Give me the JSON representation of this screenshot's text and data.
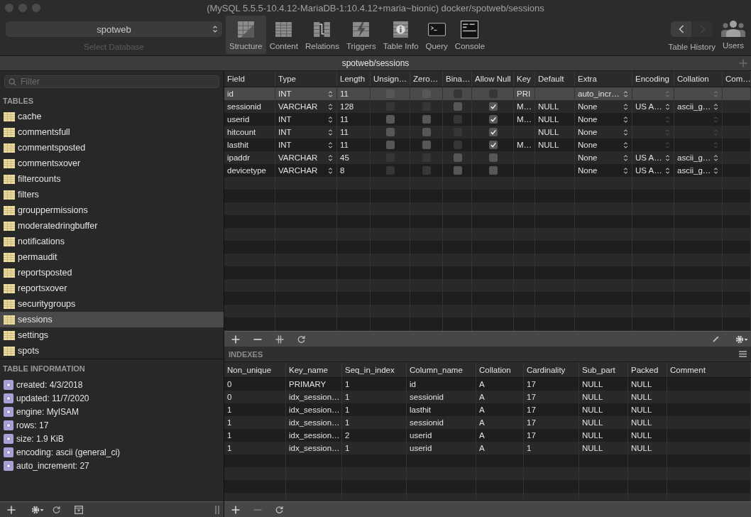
{
  "window": {
    "title": "(MySQL 5.5.5-10.4.12-MariaDB-1:10.4.12+maria~bionic) docker/spotweb/sessions"
  },
  "toolbar": {
    "database": {
      "value": "spotweb",
      "label": "Select Database"
    },
    "items": [
      {
        "label": "Structure",
        "kind": "structure",
        "selected": true
      },
      {
        "label": "Content",
        "kind": "content",
        "selected": false
      },
      {
        "label": "Relations",
        "kind": "relations",
        "selected": false
      },
      {
        "label": "Triggers",
        "kind": "triggers",
        "selected": false
      },
      {
        "label": "Table Info",
        "kind": "info",
        "selected": false
      },
      {
        "label": "Query",
        "kind": "query",
        "selected": false
      },
      {
        "label": "Console",
        "kind": "console",
        "selected": false
      }
    ],
    "history": {
      "label": "Table History",
      "back_enabled": true,
      "forward_enabled": false
    },
    "users": {
      "label": "Users"
    }
  },
  "path_bar": {
    "title": "spotweb/sessions"
  },
  "sidebar": {
    "filter": {
      "placeholder": "Filter"
    },
    "tables_title": "TABLES",
    "tables": [
      {
        "name": "cache",
        "selected": false
      },
      {
        "name": "commentsfull",
        "selected": false
      },
      {
        "name": "commentsposted",
        "selected": false
      },
      {
        "name": "commentsxover",
        "selected": false
      },
      {
        "name": "filtercounts",
        "selected": false
      },
      {
        "name": "filters",
        "selected": false
      },
      {
        "name": "grouppermissions",
        "selected": false
      },
      {
        "name": "moderatedringbuffer",
        "selected": false
      },
      {
        "name": "notifications",
        "selected": false
      },
      {
        "name": "permaudit",
        "selected": false
      },
      {
        "name": "reportsposted",
        "selected": false
      },
      {
        "name": "reportsxover",
        "selected": false
      },
      {
        "name": "securitygroups",
        "selected": false
      },
      {
        "name": "sessions",
        "selected": true
      },
      {
        "name": "settings",
        "selected": false
      },
      {
        "name": "spots",
        "selected": false
      }
    ],
    "info_title": "TABLE INFORMATION",
    "info": [
      "created: 4/3/2018",
      "updated: 11/7/2020",
      "engine: MyISAM",
      "rows: 17",
      "size: 1.9 KiB",
      "encoding: ascii (general_ci)",
      "auto_increment: 27"
    ]
  },
  "fields": {
    "columns": [
      "Field",
      "Type",
      "Length",
      "Unsign…",
      "Zero…",
      "Bina…",
      "Allow Null",
      "Key",
      "Default",
      "Extra",
      "Encoding",
      "Collation",
      "Com…"
    ],
    "rows": [
      {
        "field": "id",
        "type": "INT",
        "length": "11",
        "unsigned": {
          "checked": false,
          "enabled": true
        },
        "zerofill": {
          "checked": false,
          "enabled": true
        },
        "binary": {
          "checked": false,
          "enabled": false
        },
        "allow_null": {
          "checked": false,
          "enabled": false
        },
        "key": "PRI",
        "extra": "auto_incr…",
        "encoding": {
          "enabled": false
        },
        "collation": {
          "enabled": false
        },
        "selected": true
      },
      {
        "field": "sessionid",
        "type": "VARCHAR",
        "length": "128",
        "unsigned": {
          "checked": false,
          "enabled": false
        },
        "zerofill": {
          "checked": false,
          "enabled": false
        },
        "binary": {
          "checked": false,
          "enabled": true
        },
        "allow_null": {
          "checked": true,
          "enabled": true
        },
        "key": "M…",
        "default": "NULL",
        "extra": "None",
        "encoding": {
          "value": "US A…",
          "enabled": true
        },
        "collation": {
          "value": "ascii_g…",
          "enabled": true
        },
        "selected": false
      },
      {
        "field": "userid",
        "type": "INT",
        "length": "11",
        "unsigned": {
          "checked": false,
          "enabled": true
        },
        "zerofill": {
          "checked": false,
          "enabled": true
        },
        "binary": {
          "checked": false,
          "enabled": false
        },
        "allow_null": {
          "checked": true,
          "enabled": true
        },
        "key": "M…",
        "default": "NULL",
        "extra": "None",
        "encoding": {
          "enabled": false
        },
        "collation": {
          "enabled": false
        },
        "selected": false
      },
      {
        "field": "hitcount",
        "type": "INT",
        "length": "11",
        "unsigned": {
          "checked": false,
          "enabled": true
        },
        "zerofill": {
          "checked": false,
          "enabled": true
        },
        "binary": {
          "checked": false,
          "enabled": false
        },
        "allow_null": {
          "checked": true,
          "enabled": true
        },
        "default": "NULL",
        "extra": "None",
        "encoding": {
          "enabled": false
        },
        "collation": {
          "enabled": false
        },
        "selected": false
      },
      {
        "field": "lasthit",
        "type": "INT",
        "length": "11",
        "unsigned": {
          "checked": false,
          "enabled": true
        },
        "zerofill": {
          "checked": false,
          "enabled": true
        },
        "binary": {
          "checked": false,
          "enabled": false
        },
        "allow_null": {
          "checked": true,
          "enabled": true
        },
        "key": "M…",
        "default": "NULL",
        "extra": "None",
        "encoding": {
          "enabled": false
        },
        "collation": {
          "enabled": false
        },
        "selected": false
      },
      {
        "field": "ipaddr",
        "type": "VARCHAR",
        "length": "45",
        "unsigned": {
          "checked": false,
          "enabled": false
        },
        "zerofill": {
          "checked": false,
          "enabled": false
        },
        "binary": {
          "checked": false,
          "enabled": true
        },
        "allow_null": {
          "checked": false,
          "enabled": true
        },
        "extra": "None",
        "encoding": {
          "value": "US A…",
          "enabled": true
        },
        "collation": {
          "value": "ascii_g…",
          "enabled": true
        },
        "selected": false
      },
      {
        "field": "devicetype",
        "type": "VARCHAR",
        "length": "8",
        "unsigned": {
          "checked": false,
          "enabled": false
        },
        "zerofill": {
          "checked": false,
          "enabled": false
        },
        "binary": {
          "checked": false,
          "enabled": true
        },
        "allow_null": {
          "checked": false,
          "enabled": true
        },
        "extra": "None",
        "encoding": {
          "value": "US A…",
          "enabled": true
        },
        "collation": {
          "value": "ascii_g…",
          "enabled": true
        },
        "selected": false
      }
    ],
    "remove_enabled": true
  },
  "indexes": {
    "title": "INDEXES",
    "columns": [
      "Non_unique",
      "Key_name",
      "Seq_in_index",
      "Column_name",
      "Collation",
      "Cardinality",
      "Sub_part",
      "Packed",
      "Comment"
    ],
    "rows": [
      [
        "0",
        "PRIMARY",
        "1",
        "id",
        "A",
        "17",
        "NULL",
        "NULL"
      ],
      [
        "0",
        "idx_session…",
        "1",
        "sessionid",
        "A",
        "17",
        "NULL",
        "NULL"
      ],
      [
        "1",
        "idx_session…",
        "1",
        "lasthit",
        "A",
        "17",
        "NULL",
        "NULL"
      ],
      [
        "1",
        "idx_session…",
        "1",
        "sessionid",
        "A",
        "17",
        "NULL",
        "NULL"
      ],
      [
        "1",
        "idx_session…",
        "2",
        "userid",
        "A",
        "17",
        "NULL",
        "NULL"
      ],
      [
        "1",
        "idx_session…",
        "1",
        "userid",
        "A",
        "1",
        "NULL",
        "NULL"
      ]
    ],
    "remove_enabled": false
  }
}
